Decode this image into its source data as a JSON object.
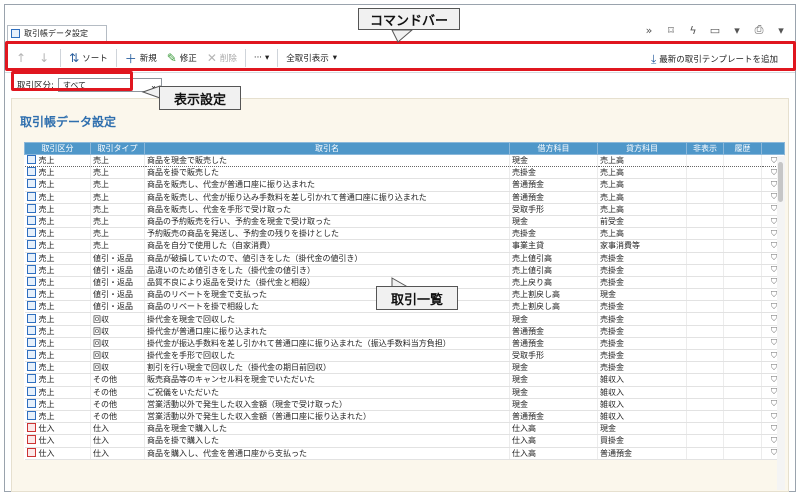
{
  "window": {
    "tab_title": "取引帳データ設定",
    "right_icons": [
      "pin-icon",
      "bookmark-icon",
      "lightning-icon",
      "window-icon",
      "dropdown-icon",
      "print-icon",
      "dropdown-icon"
    ]
  },
  "toolbar": {
    "up_label": "↑",
    "down_label": "↓",
    "sort_label": "ソート",
    "new_label": "新規",
    "edit_label": "修正",
    "delete_label": "削除",
    "more_label": "···",
    "show_all_label": "全取引表示",
    "add_template_label": "最新の取引テンプレートを追加"
  },
  "annotations": {
    "command_bar": "コマンドバー",
    "display_settings": "表示設定",
    "transaction_list": "取引一覧"
  },
  "filter": {
    "label": "取引区分:",
    "value": "すべて"
  },
  "page_title": "取引帳データ設定",
  "table": {
    "columns": [
      "取引区分",
      "取引タイプ",
      "取引名",
      "借方科目",
      "貸方科目",
      "非表示",
      "履歴",
      ""
    ],
    "rows": [
      {
        "type": "sale",
        "category": "売上",
        "trans_type": "売上",
        "name": "商品を現金で販売した",
        "debit": "現金",
        "credit": "売上高"
      },
      {
        "type": "sale",
        "category": "売上",
        "trans_type": "売上",
        "name": "商品を掛で販売した",
        "debit": "売掛金",
        "credit": "売上高"
      },
      {
        "type": "sale",
        "category": "売上",
        "trans_type": "売上",
        "name": "商品を販売し、代金が普通口座に振り込まれた",
        "debit": "普通預金",
        "credit": "売上高"
      },
      {
        "type": "sale",
        "category": "売上",
        "trans_type": "売上",
        "name": "商品を販売し、代金が振り込み手数料を差し引かれて普通口座に振り込まれた",
        "debit": "普通預金",
        "credit": "売上高"
      },
      {
        "type": "sale",
        "category": "売上",
        "trans_type": "売上",
        "name": "商品を販売し、代金を手形で受け取った",
        "debit": "受取手形",
        "credit": "売上高"
      },
      {
        "type": "sale",
        "category": "売上",
        "trans_type": "売上",
        "name": "商品の予約販売を行い、予約金を現金で受け取った",
        "debit": "現金",
        "credit": "前受金"
      },
      {
        "type": "sale",
        "category": "売上",
        "trans_type": "売上",
        "name": "予約販売の商品を発送し、予約金の残りを掛けとした",
        "debit": "売掛金",
        "credit": "売上高"
      },
      {
        "type": "sale",
        "category": "売上",
        "trans_type": "売上",
        "name": "商品を自分で使用した（自家消費）",
        "debit": "事業主貸",
        "credit": "家事消費等"
      },
      {
        "type": "sale",
        "category": "売上",
        "trans_type": "値引・返品",
        "name": "商品が破損していたので、値引きをした（掛代金の値引き）",
        "debit": "売上値引高",
        "credit": "売掛金"
      },
      {
        "type": "sale",
        "category": "売上",
        "trans_type": "値引・返品",
        "name": "品違いのため値引きをした（掛代金の値引き）",
        "debit": "売上値引高",
        "credit": "売掛金"
      },
      {
        "type": "sale",
        "category": "売上",
        "trans_type": "値引・返品",
        "name": "品質不良により返品を受けた（掛代金と相殺）",
        "debit": "売上戻り高",
        "credit": "売掛金"
      },
      {
        "type": "sale",
        "category": "売上",
        "trans_type": "値引・返品",
        "name": "商品のリベートを現金で支払った",
        "debit": "売上割戻し高",
        "credit": "現金"
      },
      {
        "type": "sale",
        "category": "売上",
        "trans_type": "値引・返品",
        "name": "商品のリベートを掛で相殺した",
        "debit": "売上割戻し高",
        "credit": "売掛金"
      },
      {
        "type": "sale",
        "category": "売上",
        "trans_type": "回収",
        "name": "掛代金を現金で回収した",
        "debit": "現金",
        "credit": "売掛金"
      },
      {
        "type": "sale",
        "category": "売上",
        "trans_type": "回収",
        "name": "掛代金が普通口座に振り込まれた",
        "debit": "普通預金",
        "credit": "売掛金"
      },
      {
        "type": "sale",
        "category": "売上",
        "trans_type": "回収",
        "name": "掛代金が振込手数料を差し引かれて普通口座に振り込まれた（振込手数料当方負担）",
        "debit": "普通預金",
        "credit": "売掛金"
      },
      {
        "type": "sale",
        "category": "売上",
        "trans_type": "回収",
        "name": "掛代金を手形で回収した",
        "debit": "受取手形",
        "credit": "売掛金"
      },
      {
        "type": "sale",
        "category": "売上",
        "trans_type": "回収",
        "name": "割引を行い現金で回収した（掛代金の期日前回収）",
        "debit": "現金",
        "credit": "売掛金"
      },
      {
        "type": "sale",
        "category": "売上",
        "trans_type": "その他",
        "name": "販売商品等のキャンセル料を現金でいただいた",
        "debit": "現金",
        "credit": "雑収入"
      },
      {
        "type": "sale",
        "category": "売上",
        "trans_type": "その他",
        "name": "ご祝儀をいただいた",
        "debit": "現金",
        "credit": "雑収入"
      },
      {
        "type": "sale",
        "category": "売上",
        "trans_type": "その他",
        "name": "営業活動以外で発生した収入金額（現金で受け取った）",
        "debit": "現金",
        "credit": "雑収入"
      },
      {
        "type": "sale",
        "category": "売上",
        "trans_type": "その他",
        "name": "営業活動以外で発生した収入金額（普通口座に振り込まれた）",
        "debit": "普通預金",
        "credit": "雑収入"
      },
      {
        "type": "purchase",
        "category": "仕入",
        "trans_type": "仕入",
        "name": "商品を現金で購入した",
        "debit": "仕入高",
        "credit": "現金"
      },
      {
        "type": "purchase",
        "category": "仕入",
        "trans_type": "仕入",
        "name": "商品を掛で購入した",
        "debit": "仕入高",
        "credit": "買掛金"
      },
      {
        "type": "purchase",
        "category": "仕入",
        "trans_type": "仕入",
        "name": "商品を購入し、代金を普通口座から支払った",
        "debit": "仕入高",
        "credit": "普通預金"
      }
    ]
  }
}
